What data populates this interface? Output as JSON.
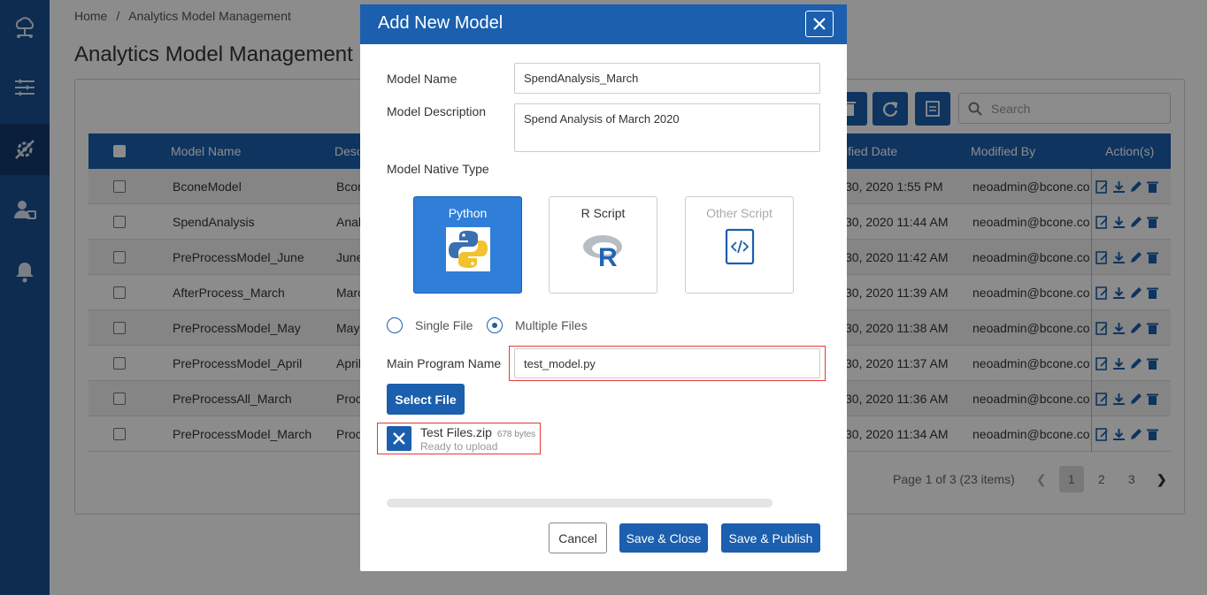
{
  "breadcrumb": {
    "home": "Home",
    "separator": "/",
    "current": "Analytics Model Management"
  },
  "page_title": "Analytics Model Management",
  "sidebar": {
    "icons": [
      "cloud-network-icon",
      "sliders-icon",
      "settings-tools-icon",
      "user-management-icon",
      "bell-icon"
    ],
    "active_index": 2
  },
  "toolbar": {
    "buttons": [
      "delete-icon",
      "refresh-icon",
      "export-xlsx-icon"
    ],
    "search_placeholder": "Search"
  },
  "grid": {
    "columns": [
      "Model Name",
      "Desc",
      "ified Date",
      "Modified By",
      "Action(s)"
    ],
    "rows": [
      {
        "name": "BconeModel",
        "desc": "Bcon",
        "date": "30, 2020 1:55 PM",
        "by": "neoadmin@bcone.com"
      },
      {
        "name": "SpendAnalysis",
        "desc": "Anal",
        "date": "30, 2020 11:44 AM",
        "by": "neoadmin@bcone.com"
      },
      {
        "name": "PreProcessModel_June",
        "desc": "June",
        "date": "30, 2020 11:42 AM",
        "by": "neoadmin@bcone.com"
      },
      {
        "name": "AfterProcess_March",
        "desc": "Marc",
        "date": "30, 2020 11:39 AM",
        "by": "neoadmin@bcone.com"
      },
      {
        "name": "PreProcessModel_May",
        "desc": "May",
        "date": "30, 2020 11:38 AM",
        "by": "neoadmin@bcone.com"
      },
      {
        "name": "PreProcessModel_April",
        "desc": "April",
        "date": "30, 2020 11:37 AM",
        "by": "neoadmin@bcone.com"
      },
      {
        "name": "PreProcessAll_March",
        "desc": "Proc",
        "date": "30, 2020 11:36 AM",
        "by": "neoadmin@bcone.com"
      },
      {
        "name": "PreProcessModel_March",
        "desc": "Proc",
        "date": "30, 2020 11:34 AM",
        "by": "neoadmin@bcone.com"
      }
    ]
  },
  "pager": {
    "summary": "Page 1 of 3 (23 items)",
    "pages": [
      "1",
      "2",
      "3"
    ],
    "current": "1"
  },
  "modal": {
    "title": "Add New Model",
    "model_name_label": "Model Name",
    "model_name_value": "SpendAnalysis_March",
    "model_desc_label": "Model Description",
    "model_desc_value": "Spend Analysis of March 2020",
    "native_type_label": "Model Native Type",
    "types": [
      {
        "label": "Python",
        "state": "selected",
        "icon": "python-logo-icon"
      },
      {
        "label": "R Script",
        "state": "normal",
        "icon": "r-logo-icon"
      },
      {
        "label": "Other Script",
        "state": "disabled",
        "icon": "code-file-icon"
      }
    ],
    "file_mode": {
      "single": "Single File",
      "multiple": "Multiple Files",
      "selected": "multiple"
    },
    "main_program_label": "Main Program Name",
    "main_program_value": "test_model.py",
    "select_file_label": "Select File",
    "file": {
      "name": "Test Files.zip",
      "size": "678 bytes",
      "status": "Ready to upload"
    },
    "upload_progress": 0,
    "buttons": {
      "cancel": "Cancel",
      "save_close": "Save & Close",
      "save_publish": "Save & Publish"
    }
  },
  "colors": {
    "primary": "#1b5fae",
    "sidebar": "#1b4f93",
    "highlight": "#e53935",
    "python_card": "#2f7ed8"
  }
}
